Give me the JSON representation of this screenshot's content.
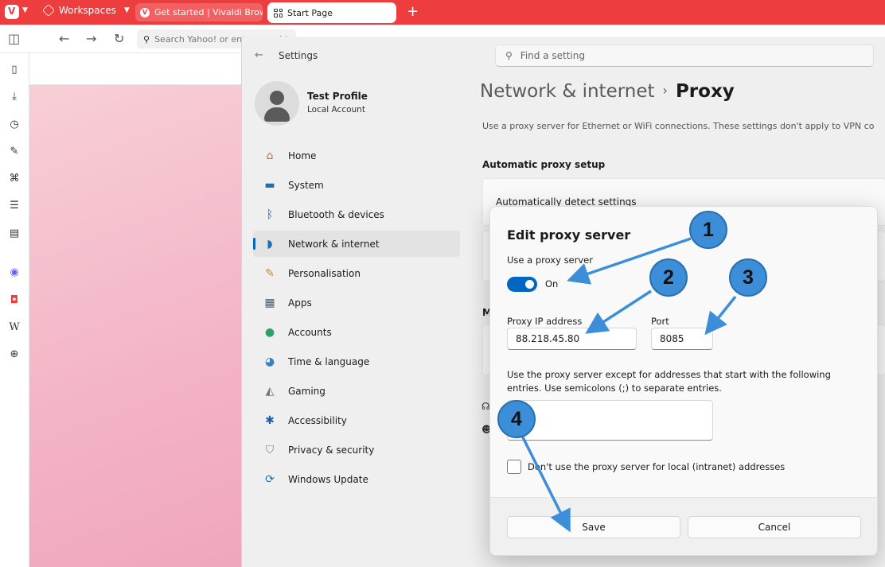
{
  "browser": {
    "workspaces_label": "Workspaces",
    "tabs": [
      {
        "label": "Get started | Vivaldi Browser"
      },
      {
        "label": "Start Page"
      }
    ],
    "new_tab": "+",
    "address_placeholder": "Search Yahoo! or enter an address"
  },
  "settings": {
    "title": "Settings",
    "search_placeholder": "Find a setting",
    "profile": {
      "name": "Test Profile",
      "account": "Local Account"
    },
    "nav": [
      {
        "label": "Home",
        "icon": "home-icon"
      },
      {
        "label": "System",
        "icon": "system-icon"
      },
      {
        "label": "Bluetooth & devices",
        "icon": "bluetooth-icon"
      },
      {
        "label": "Network & internet",
        "icon": "wifi-icon",
        "active": true
      },
      {
        "label": "Personalisation",
        "icon": "brush-icon"
      },
      {
        "label": "Apps",
        "icon": "apps-icon"
      },
      {
        "label": "Accounts",
        "icon": "accounts-icon"
      },
      {
        "label": "Time & language",
        "icon": "globe-icon"
      },
      {
        "label": "Gaming",
        "icon": "gamepad-icon"
      },
      {
        "label": "Accessibility",
        "icon": "accessibility-icon"
      },
      {
        "label": "Privacy & security",
        "icon": "shield-icon"
      },
      {
        "label": "Windows Update",
        "icon": "update-icon"
      }
    ],
    "breadcrumb": {
      "parent": "Network & internet",
      "separator": "›",
      "current": "Proxy"
    },
    "description": "Use a proxy server for Ethernet or WiFi connections. These settings don't apply to VPN co",
    "automatic_header": "Automatic proxy setup",
    "auto_detect_label": "Automatically detect settings",
    "manual_header_partial": "M"
  },
  "dialog": {
    "title": "Edit proxy server",
    "use_proxy_label": "Use a proxy server",
    "toggle_state": "On",
    "ip_label": "Proxy IP address",
    "ip_value": "88.218.45.80",
    "port_label": "Port",
    "port_value": "8085",
    "exceptions_text": "Use the proxy server except for addresses that start with the following entries. Use semicolons (;) to separate entries.",
    "exceptions_value": "",
    "local_checkbox_label": "Don't use the proxy server for local (intranet) addresses",
    "save_label": "Save",
    "cancel_label": "Cancel"
  },
  "annotations": [
    {
      "number": "1"
    },
    {
      "number": "2"
    },
    {
      "number": "3"
    },
    {
      "number": "4"
    }
  ],
  "colors": {
    "vivaldi_red": "#ee3d3f",
    "accent": "#0067c0",
    "marker_blue": "#3d8ed9"
  }
}
